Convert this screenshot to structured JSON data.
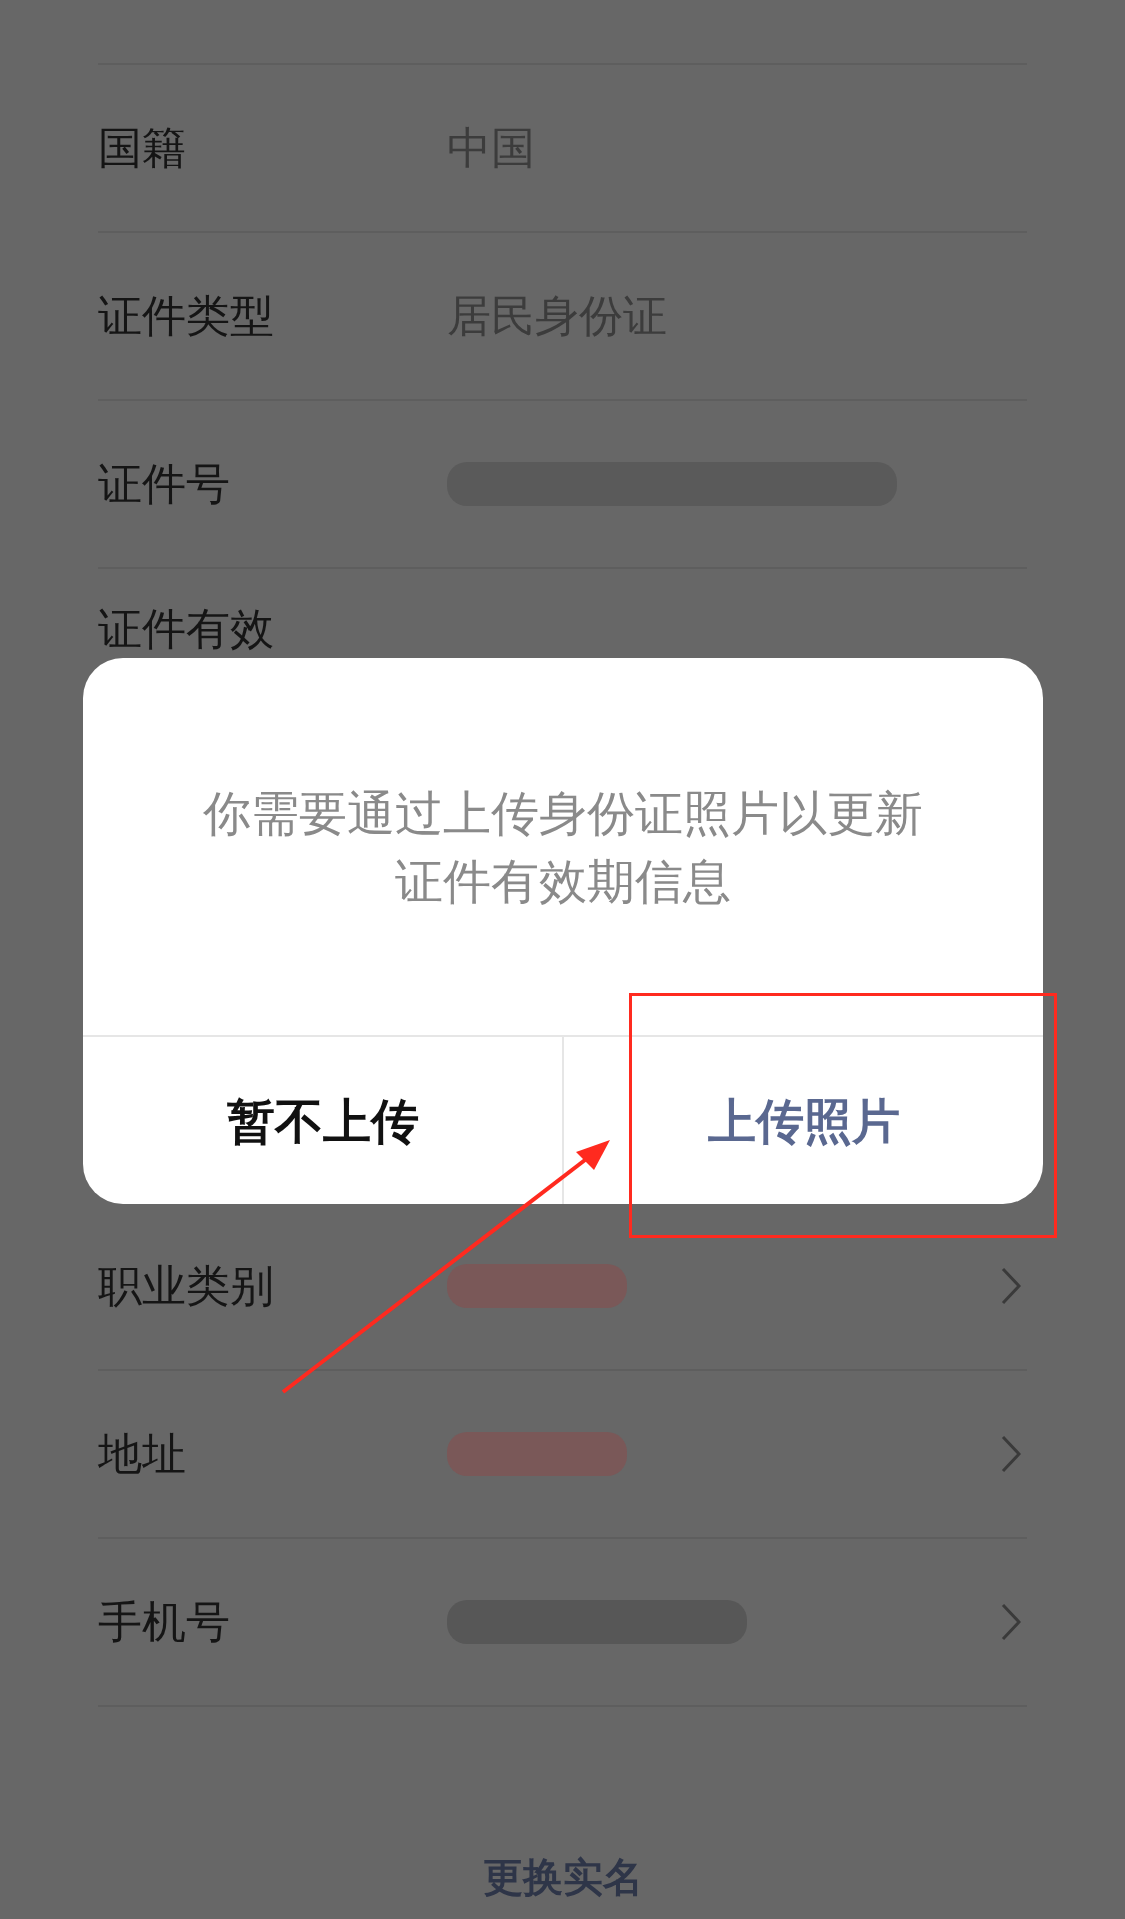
{
  "rows": [
    {
      "label": "国籍",
      "kind": "text",
      "value": "中国",
      "chevron": false
    },
    {
      "label": "证件类型",
      "kind": "text",
      "value": "居民身份证",
      "chevron": false
    },
    {
      "label": "证件号",
      "kind": "redacted",
      "color": "#5a5a5a",
      "chevron": false
    },
    {
      "label": "证件有效",
      "kind": "label_only",
      "chevron": false
    },
    {
      "label": "职业类别",
      "kind": "redacted",
      "color": "#7a5858",
      "chevron": true
    },
    {
      "label": "地址",
      "kind": "redacted",
      "color": "#7a5858",
      "chevron": true
    },
    {
      "label": "手机号",
      "kind": "redacted",
      "color": "#575757",
      "chevron": true
    }
  ],
  "dialog": {
    "message": "你需要通过上传身份证照片以更新证件有效期信息",
    "buttons": [
      {
        "label": "暂不上传",
        "kind": "cancel"
      },
      {
        "label": "上传照片",
        "kind": "confirm"
      }
    ]
  },
  "footer_link": "更换实名",
  "annotations": {
    "highlight_box": true,
    "arrow": true
  }
}
